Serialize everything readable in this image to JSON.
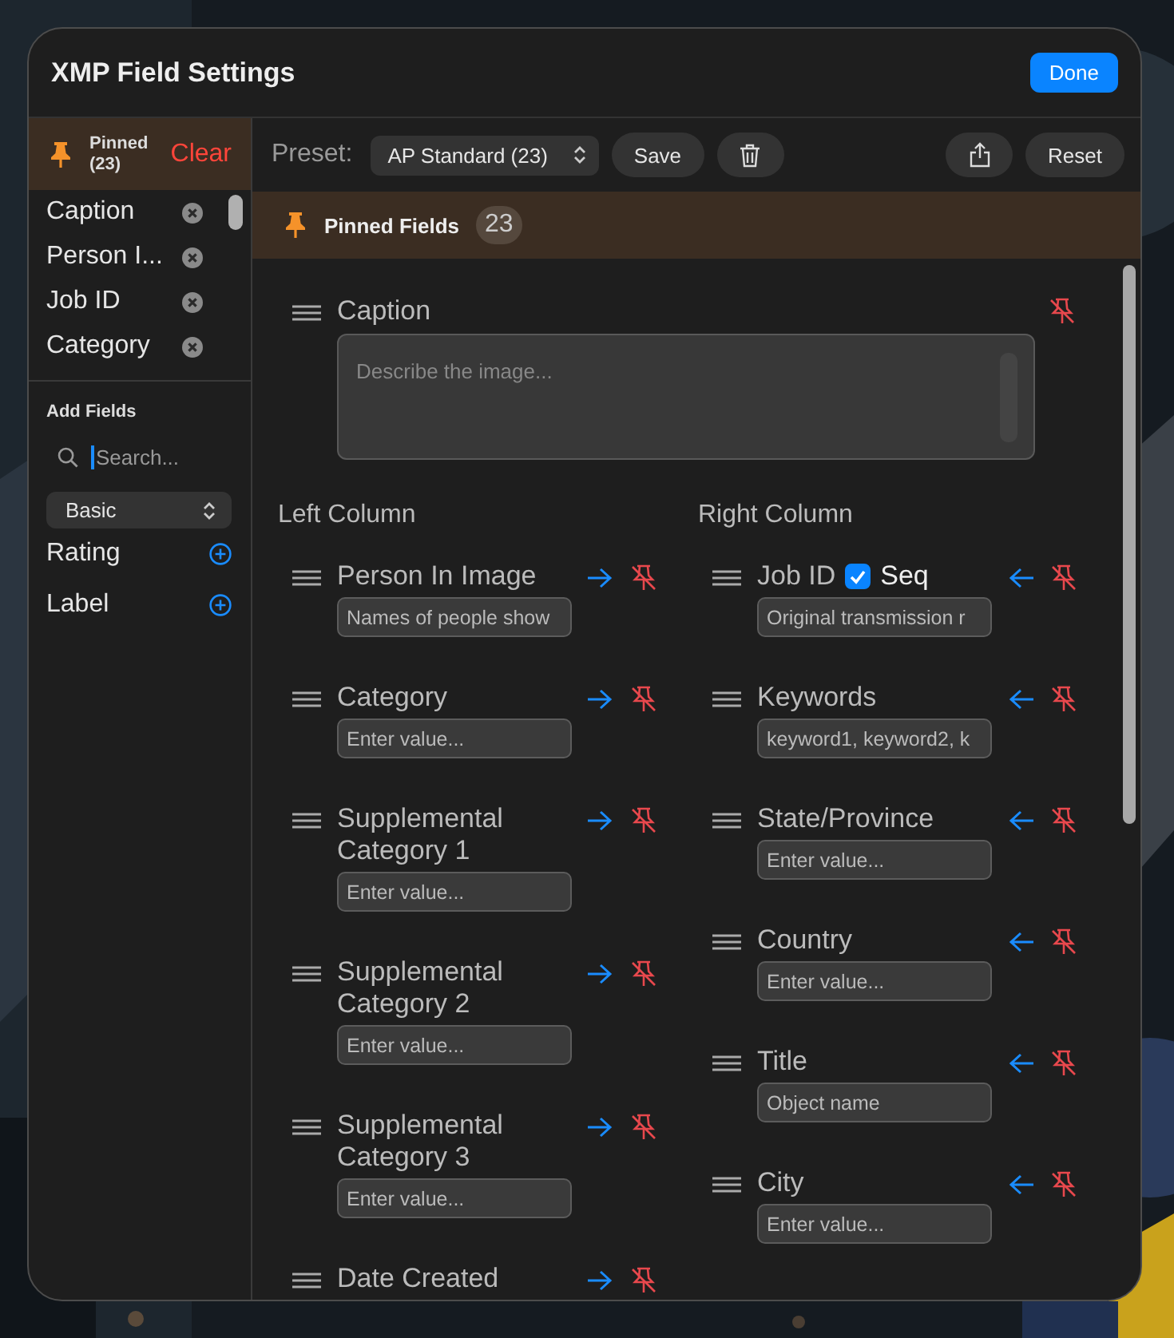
{
  "dialog": {
    "title": "XMP Field Settings",
    "done_button": "Done"
  },
  "sidebar": {
    "pinned_header": {
      "label": "Pinned (23)",
      "clear_button": "Clear"
    },
    "pinned_items": [
      "Caption",
      "Person I...",
      "Job ID",
      "Category"
    ],
    "add_fields": {
      "heading": "Add Fields",
      "search": {
        "placeholder": "Search..."
      },
      "category_select": "Basic",
      "items": [
        "Rating",
        "Label"
      ]
    }
  },
  "toolbar": {
    "preset_label": "Preset:",
    "preset_select": "AP Standard (23)",
    "save_button": "Save",
    "reset_button": "Reset"
  },
  "pinned_band": {
    "title": "Pinned Fields",
    "count": "23"
  },
  "caption_field": {
    "label": "Caption",
    "placeholder": "Describe the image..."
  },
  "left_column": {
    "heading": "Left Column",
    "fields": [
      {
        "label": "Person In Image",
        "placeholder": "Names of people show"
      },
      {
        "label": "Category",
        "placeholder": "Enter value..."
      },
      {
        "label": "Supplemental Category 1",
        "placeholder": "Enter value..."
      },
      {
        "label": "Supplemental Category 2",
        "placeholder": "Enter value..."
      },
      {
        "label": "Supplemental Category 3",
        "placeholder": "Enter value..."
      },
      {
        "label": "Date Created"
      }
    ]
  },
  "right_column": {
    "heading": "Right Column",
    "fields": [
      {
        "label": "Job ID",
        "placeholder": "Original transmission r",
        "sequence": {
          "label": "Seq",
          "checked": true
        }
      },
      {
        "label": "Keywords",
        "placeholder": "keyword1, keyword2, k"
      },
      {
        "label": "State/Province",
        "placeholder": "Enter value..."
      },
      {
        "label": "Country",
        "placeholder": "Enter value..."
      },
      {
        "label": "Title",
        "placeholder": "Object name"
      },
      {
        "label": "City",
        "placeholder": "Enter value..."
      }
    ]
  }
}
